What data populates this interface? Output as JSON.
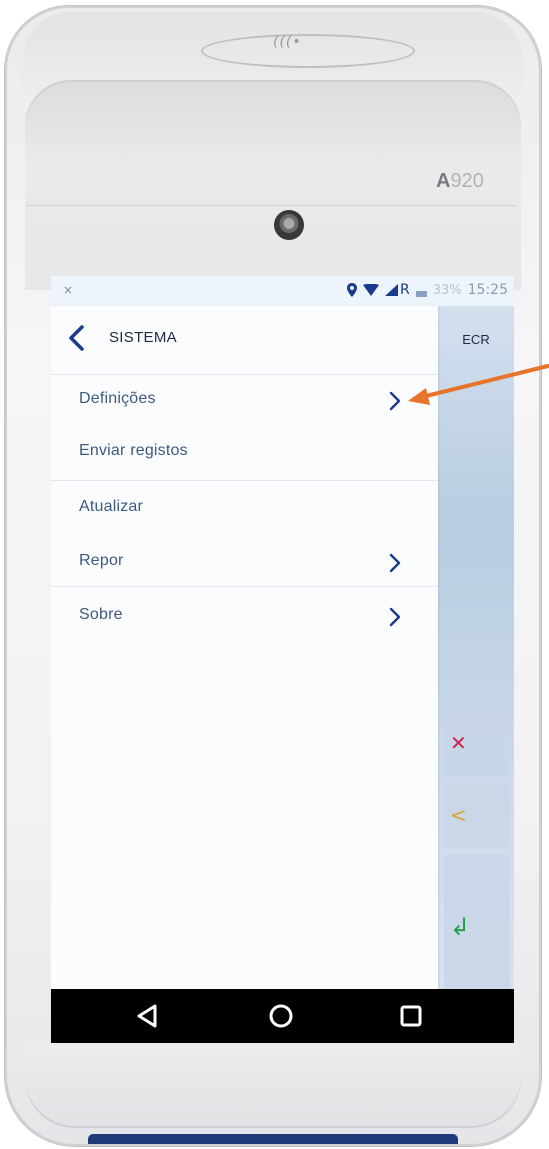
{
  "device": {
    "model_prefix": "A",
    "model_number": "920",
    "nfc_glyph": "(((•"
  },
  "status_bar": {
    "left_icon": "×",
    "location_icon": "location-pin-icon",
    "wifi_icon": "wifi-icon",
    "signal_icon": "signal-icon",
    "network_label": "R",
    "battery_percent": "33%",
    "time": "15:25"
  },
  "drawer": {
    "title": "SISTEMA",
    "items": [
      {
        "label": "Definições",
        "has_chevron": true
      },
      {
        "label": "Enviar registos",
        "has_chevron": false
      },
      {
        "label": "Atualizar",
        "has_chevron": false
      },
      {
        "label": "Repor",
        "has_chevron": true
      },
      {
        "label": "Sobre",
        "has_chevron": true
      }
    ]
  },
  "background_app": {
    "header_label": "ECR",
    "keys": {
      "cancel": "✕",
      "back": "<",
      "enter": "↲"
    }
  },
  "nav_bar": {
    "back": "back-triangle-icon",
    "home": "home-circle-icon",
    "recents": "recents-square-icon"
  },
  "colors": {
    "accent": "#1a3b8c",
    "menu_text": "#3d5a80",
    "annotation_arrow": "#e8732a",
    "cancel": "#d1234a",
    "back": "#d7a52a",
    "enter": "#23a04d"
  }
}
